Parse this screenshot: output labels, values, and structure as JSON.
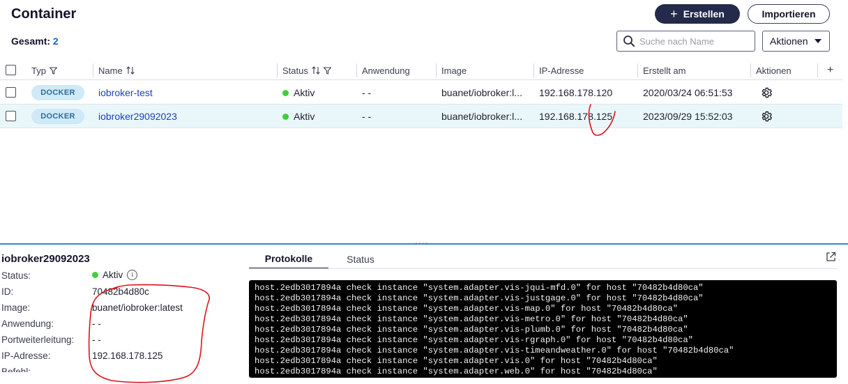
{
  "header": {
    "title": "Container",
    "total_label": "Gesamt:",
    "total_count": "2",
    "create_label": "Erstellen",
    "import_label": "Importieren",
    "search_placeholder": "Suche nach Name",
    "actions_label": "Aktionen"
  },
  "table": {
    "columns": [
      "Typ",
      "Name",
      "Status",
      "Anwendung",
      "Image",
      "IP-Adresse",
      "Erstellt am",
      "Aktionen"
    ],
    "add_column": "+",
    "rows": [
      {
        "type": "DOCKER",
        "name": "iobroker-test",
        "status": "Aktiv",
        "app": "- -",
        "image": "buanet/iobroker:l...",
        "ip": "192.168.178.120",
        "created": "2020/03/24 06:51:53"
      },
      {
        "type": "DOCKER",
        "name": "iobroker29092023",
        "status": "Aktiv",
        "app": "- -",
        "image": "buanet/iobroker:l...",
        "ip": "192.168.178.125",
        "created": "2023/09/29 15:52:03"
      }
    ]
  },
  "resize_handle": "....",
  "details": {
    "title": "iobroker29092023",
    "fields": [
      {
        "label": "Status:",
        "value": "Aktiv"
      },
      {
        "label": "ID:",
        "value": "70482b4d80c"
      },
      {
        "label": "Image:",
        "value": "buanet/iobroker:latest"
      },
      {
        "label": "Anwendung:",
        "value": "- -"
      },
      {
        "label": "Portweiterleitung:",
        "value": "- -"
      },
      {
        "label": "IP-Adresse:",
        "value": "192.168.178.125"
      },
      {
        "label": "Befehl:",
        "value": ""
      }
    ],
    "info_glyph": "i",
    "tabs": [
      "Protokolle",
      "Status"
    ],
    "log_lines": [
      "host.2edb3017894a check instance \"system.adapter.vis-jqui-mfd.0\" for host \"70482b4d80ca\"",
      "host.2edb3017894a check instance \"system.adapter.vis-justgage.0\" for host \"70482b4d80ca\"",
      "host.2edb3017894a check instance \"system.adapter.vis-map.0\" for host \"70482b4d80ca\"",
      "host.2edb3017894a check instance \"system.adapter.vis-metro.0\" for host \"70482b4d80ca\"",
      "host.2edb3017894a check instance \"system.adapter.vis-plumb.0\" for host \"70482b4d80ca\"",
      "host.2edb3017894a check instance \"system.adapter.vis-rgraph.0\" for host \"70482b4d80ca\"",
      "host.2edb3017894a check instance \"system.adapter.vis-timeandweather.0\" for host \"70482b4d80ca\"",
      "host.2edb3017894a check instance \"system.adapter.vis.0\" for host \"70482b4d80ca\"",
      "host.2edb3017894a check instance \"system.adapter.web.0\" for host \"70482b4d80ca\""
    ]
  },
  "colors": {
    "accent": "#242a4a",
    "link": "#1d3fbf",
    "status_active": "#3ecf3e",
    "badge_bg": "#cfe9f7",
    "selected_row": "#e9f7fb",
    "annotation": "#e0101a"
  },
  "icons": {
    "search": "search-icon",
    "dropdown": "chevron-down-icon",
    "filter": "filter-icon",
    "sort": "sort-icon",
    "settings": "gear-icon",
    "info": "info-icon",
    "external": "external-link-icon"
  }
}
